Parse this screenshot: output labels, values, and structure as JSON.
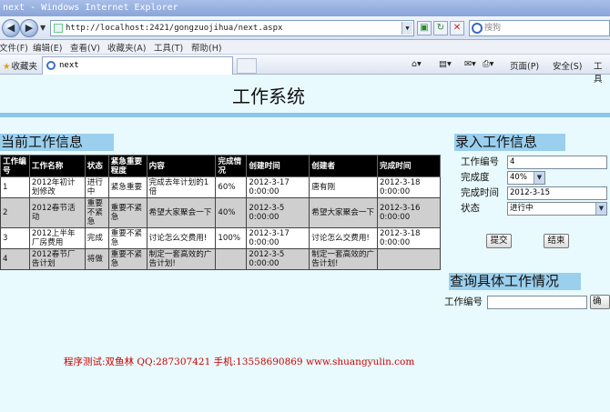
{
  "browser": {
    "window_title": "next - Windows Internet Explorer",
    "url": "http://localhost:2421/gongzuojihua/next.aspx",
    "search_placeholder": "搜狗",
    "menu": [
      "文件(F)",
      "编辑(E)",
      "查看(V)",
      "收藏夹(A)",
      "工具(T)",
      "帮助(H)"
    ],
    "favorites_label": "收藏夹",
    "tab_title": "next",
    "commands": [
      "页面(P)",
      "安全(S)",
      "工具"
    ]
  },
  "page": {
    "title": "工作系统"
  },
  "current": {
    "header": "当前工作信息",
    "columns": [
      "工作编号",
      "工作名称",
      "状态",
      "紧急重要程度",
      "内容",
      "完成情况",
      "创建时间",
      "创建者",
      "完成时间"
    ],
    "rows": [
      [
        "1",
        "2012年初计划修改",
        "进行中",
        "紧急重要",
        "完成去年计划的1倍",
        "60%",
        "2012-3-17 0:00:00",
        "唐有刚",
        "2012-3-18 0:00:00"
      ],
      [
        "2",
        "2012春节活动",
        "重要不紧急",
        "重要不紧急",
        "希望大家聚会一下",
        "40%",
        "2012-3-5 0:00:00",
        "希望大家聚会一下",
        "2012-3-16 0:00:00"
      ],
      [
        "3",
        "2012上半年厂房费用",
        "完成",
        "重要不紧急",
        "讨论怎么交费用!",
        "100%",
        "2012-3-17 0:00:00",
        "讨论怎么交费用!",
        "2012-3-18 0:00:00"
      ],
      [
        "4",
        "2012春节厂告计划",
        "将做",
        "重要不紧急",
        "制定一套高效的广告计划!",
        "",
        "2012-3-5 0:00:00",
        "制定一套高效的广告计划!",
        ""
      ]
    ]
  },
  "entry": {
    "header": "录入工作信息",
    "id_label": "工作编号",
    "id_value": "4",
    "completion_label": "完成度",
    "completion_value": "40%",
    "done_time_label": "完成时间",
    "done_time_value": "2012-3-15",
    "status_label": "状态",
    "status_value": "进行中",
    "submit_label": "提交",
    "end_label": "结束"
  },
  "query": {
    "header": "查询具体工作情况",
    "id_label": "工作编号",
    "id_value": "",
    "confirm_label": "确定"
  },
  "footer": {
    "credit": "程序测试:双鱼林 QQ:287307421 手机:13558690869 www.shuangyulin.com"
  }
}
